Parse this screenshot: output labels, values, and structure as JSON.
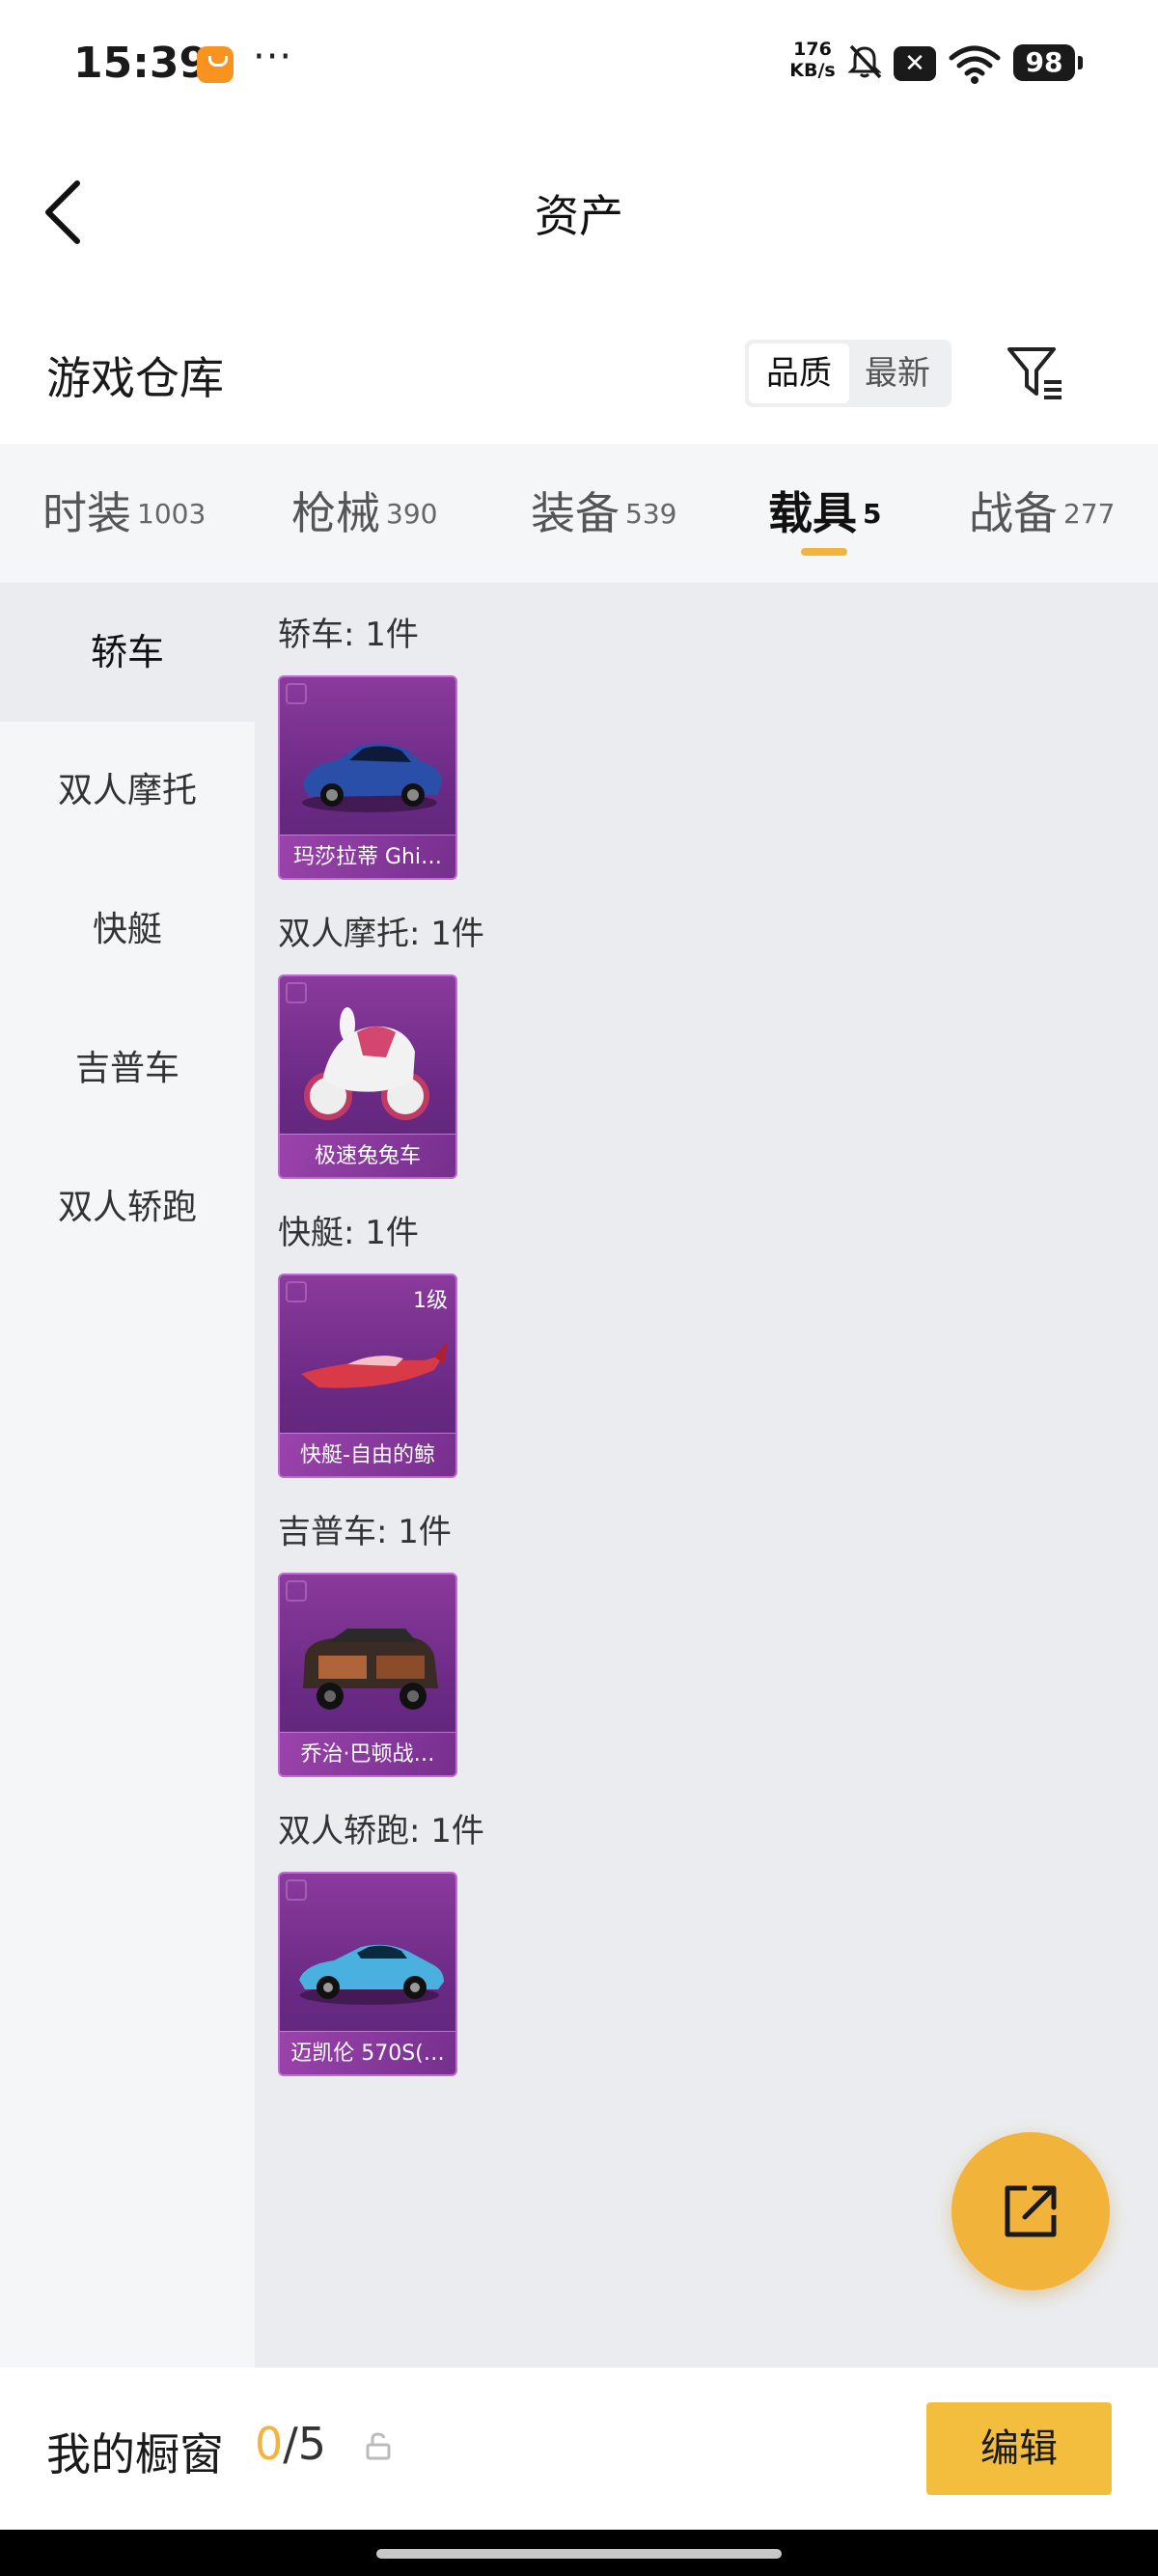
{
  "status_bar": {
    "time": "15:39",
    "more": "···",
    "net_speed_value": "176",
    "net_speed_unit": "KB/s",
    "sim_icon": "✕",
    "battery": "98",
    "icons": [
      "app-notification-icon",
      "mute-icon",
      "sim-x-icon",
      "wifi-icon",
      "battery-icon"
    ]
  },
  "header": {
    "title": "资产"
  },
  "warehouse": {
    "title": "游戏仓库",
    "sort_options": [
      "品质",
      "最新"
    ],
    "selected_sort": "品质"
  },
  "tabs": [
    {
      "label": "时装",
      "count": "1003"
    },
    {
      "label": "枪械",
      "count": "390"
    },
    {
      "label": "装备",
      "count": "539"
    },
    {
      "label": "载具",
      "count": "5",
      "active": true
    },
    {
      "label": "战备",
      "count": "277"
    }
  ],
  "sidebar": {
    "items": [
      "轿车",
      "双人摩托",
      "快艇",
      "吉普车",
      "双人轿跑"
    ],
    "active": "轿车"
  },
  "sections": [
    {
      "title": "轿车: 1件",
      "item_name": "玛莎拉蒂 Ghi…",
      "level": ""
    },
    {
      "title": "双人摩托: 1件",
      "item_name": "极速兔兔车",
      "level": ""
    },
    {
      "title": "快艇: 1件",
      "item_name": "快艇-自由的鲸",
      "level": "1级"
    },
    {
      "title": "吉普车: 1件",
      "item_name": "乔治·巴顿战…",
      "level": ""
    },
    {
      "title": "双人轿跑: 1件",
      "item_name": "迈凯伦 570S(…",
      "level": ""
    }
  ],
  "bottom_bar": {
    "showcase_label": "我的橱窗",
    "showcase_current": "0",
    "showcase_sep": "/",
    "showcase_max": "5",
    "edit_label": "编辑"
  },
  "colors": {
    "accent": "#f3b33d",
    "card_purple": "#6b2a85",
    "content_bg": "#eaecef"
  }
}
